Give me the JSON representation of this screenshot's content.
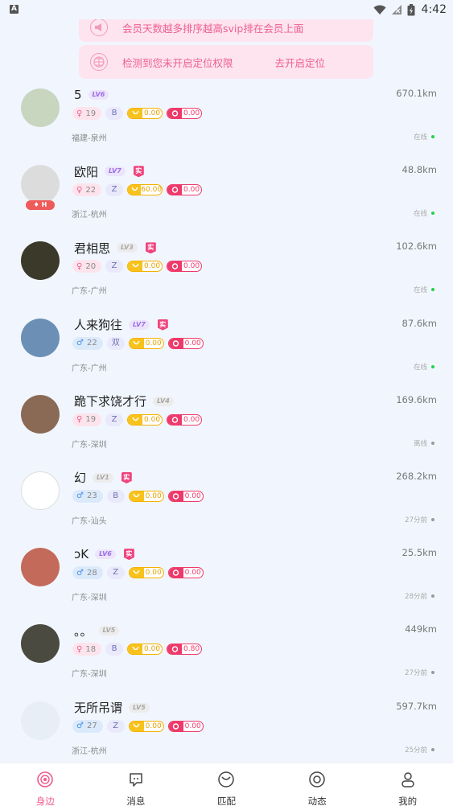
{
  "status_bar": {
    "notification_icon": "A",
    "time": "4:42"
  },
  "banners": {
    "vip_text": "会员天数越多排序越高svip排在会员上面",
    "location_text": "检测到您未开启定位权限",
    "location_action": "去开启定位"
  },
  "users": [
    {
      "nick": "5",
      "level": "LV6",
      "lv_style": "hi",
      "real": false,
      "gender": "f",
      "gender_symbol": "♀",
      "age": "19",
      "tag": "B",
      "gold": "0.00",
      "red": "0.00",
      "location": "福建-泉州",
      "distance": "670.1km",
      "status": "在线",
      "online": true,
      "avatar_bg": "#c8d6c0",
      "badge": ""
    },
    {
      "nick": "欧阳",
      "level": "LV7",
      "lv_style": "hi",
      "real": true,
      "real_label": "实",
      "gender": "f",
      "gender_symbol": "♀",
      "age": "22",
      "tag": "Z",
      "gold": "60.00",
      "red": "0.00",
      "location": "浙江-杭州",
      "distance": "48.8km",
      "status": "在线",
      "online": true,
      "avatar_bg": "#dcdcdc",
      "badge": "♦ H"
    },
    {
      "nick": "君相思",
      "level": "LV3",
      "lv_style": "lo",
      "real": true,
      "real_label": "实",
      "gender": "f",
      "gender_symbol": "♀",
      "age": "20",
      "tag": "Z",
      "gold": "0.00",
      "red": "0.00",
      "location": "广东-广州",
      "distance": "102.6km",
      "status": "在线",
      "online": true,
      "avatar_bg": "#3b3a2a",
      "badge": ""
    },
    {
      "nick": "人来狗往",
      "level": "LV7",
      "lv_style": "hi",
      "real": true,
      "real_label": "实",
      "gender": "m",
      "gender_symbol": "♂",
      "age": "22",
      "tag": "双",
      "gold": "0.00",
      "red": "0.00",
      "location": "广东-广州",
      "distance": "87.6km",
      "status": "在线",
      "online": true,
      "avatar_bg": "#6b8fb5",
      "badge": ""
    },
    {
      "nick": "跪下求饶才行",
      "level": "LV4",
      "lv_style": "lo",
      "real": false,
      "gender": "f",
      "gender_symbol": "♀",
      "age": "19",
      "tag": "Z",
      "gold": "0.00",
      "red": "0.00",
      "location": "广东-深圳",
      "distance": "169.6km",
      "status": "离线",
      "online": false,
      "avatar_bg": "#8a6a55",
      "badge": ""
    },
    {
      "nick": "幻",
      "level": "LV1",
      "lv_style": "lo",
      "real": true,
      "real_label": "实",
      "gender": "m",
      "gender_symbol": "♂",
      "age": "23",
      "tag": "B",
      "gold": "0.00",
      "red": "0.00",
      "location": "广东-汕头",
      "distance": "268.2km",
      "status": "27分前",
      "online": false,
      "avatar_bg": "#ffffff",
      "badge": ""
    },
    {
      "nick": "ↄK",
      "level": "LV6",
      "lv_style": "hi",
      "real": true,
      "real_label": "实",
      "gender": "m",
      "gender_symbol": "♂",
      "age": "28",
      "tag": "Z",
      "gold": "0.00",
      "red": "0.00",
      "location": "广东-深圳",
      "distance": "25.5km",
      "status": "28分前",
      "online": false,
      "avatar_bg": "#c46a5a",
      "badge": ""
    },
    {
      "nick": "。。",
      "level": "LV5",
      "lv_style": "lo",
      "real": false,
      "gender": "f",
      "gender_symbol": "♀",
      "age": "18",
      "tag": "B",
      "gold": "0.00",
      "red": "0.80",
      "location": "广东-深圳",
      "distance": "449km",
      "status": "27分前",
      "online": false,
      "avatar_bg": "#4a4a40",
      "badge": ""
    },
    {
      "nick": "无所吊谓",
      "level": "LV5",
      "lv_style": "lo",
      "real": false,
      "gender": "m",
      "gender_symbol": "♂",
      "age": "27",
      "tag": "Z",
      "gold": "0.00",
      "red": "0.00",
      "location": "浙江-杭州",
      "distance": "597.7km",
      "status": "25分前",
      "online": false,
      "avatar_bg": "#e8eef5",
      "badge": ""
    }
  ],
  "tabs": [
    {
      "label": "身边",
      "icon": "nearby-icon",
      "active": true
    },
    {
      "label": "消息",
      "icon": "message-icon",
      "active": false
    },
    {
      "label": "匹配",
      "icon": "match-icon",
      "active": false
    },
    {
      "label": "动态",
      "icon": "moments-icon",
      "active": false
    },
    {
      "label": "我的",
      "icon": "profile-icon",
      "active": false
    }
  ],
  "colors": {
    "accent": "#f05a8e",
    "online": "#22d14a",
    "page_bg": "#f1f6fe"
  }
}
